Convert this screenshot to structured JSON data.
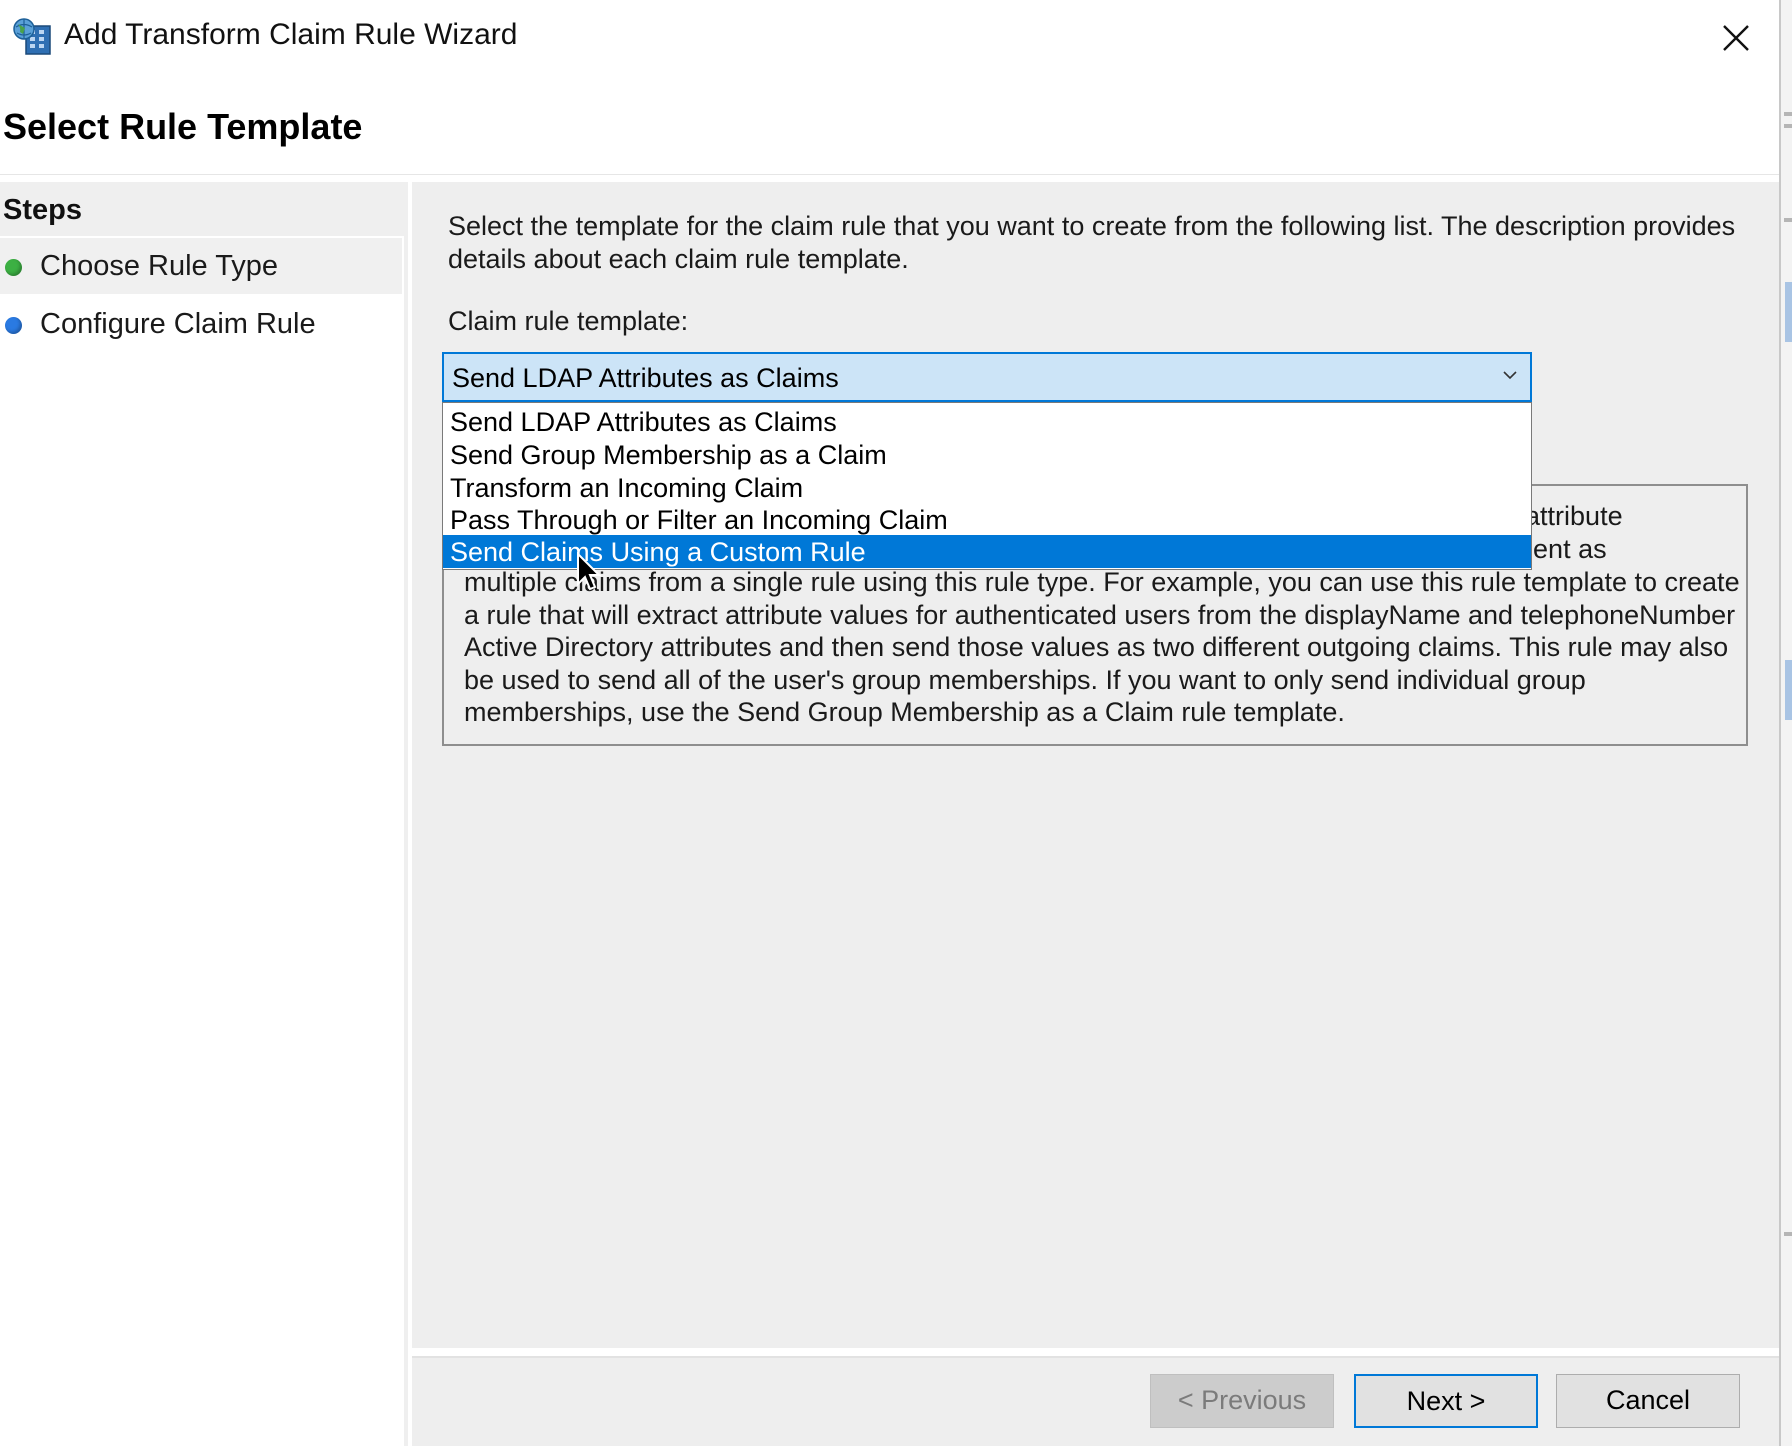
{
  "window": {
    "title": "Add Transform Claim Rule Wizard",
    "page_title": "Select Rule Template"
  },
  "steps": {
    "heading": "Steps",
    "items": [
      {
        "label": "Choose Rule Type",
        "dot_color": "#3cb043",
        "current": true
      },
      {
        "label": "Configure Claim Rule",
        "dot_color": "#2a7ae2",
        "current": false
      }
    ]
  },
  "main": {
    "description": "Select the template for the claim rule that you want to create from the following list. The description provides details about each claim rule template.",
    "template_label": "Claim rule template:",
    "template_select": {
      "value": "Send LDAP Attributes as Claims",
      "options": [
        "Send LDAP Attributes as Claims",
        "Send Group Membership as a Claim",
        "Transform an Incoming Claim",
        "Pass Through or Filter an Incoming Claim",
        "Send Claims Using a Custom Rule"
      ],
      "highlighted_option": "Send Claims Using a Custom Rule"
    },
    "template_description_visible": [
      "AP attribute",
      "be sent as",
      "multiple claims from a single rule using this rule type. For example, you can use this rule template to create",
      "a rule that will extract attribute values for authenticated users from the displayName and telephoneNumber",
      "Active Directory attributes and then send those values as two different outgoing claims. This rule may also",
      "be used to send all of the user's group memberships. If you want to only send individual group",
      "memberships, use the Send Group Membership as a Claim rule template."
    ]
  },
  "footer": {
    "previous_label": "< Previous",
    "next_label": "Next >",
    "cancel_label": "Cancel",
    "previous_enabled": false
  },
  "colors": {
    "accent": "#0078d7",
    "select_bg": "#cce4f7",
    "panel_bg": "#eeeeee"
  }
}
